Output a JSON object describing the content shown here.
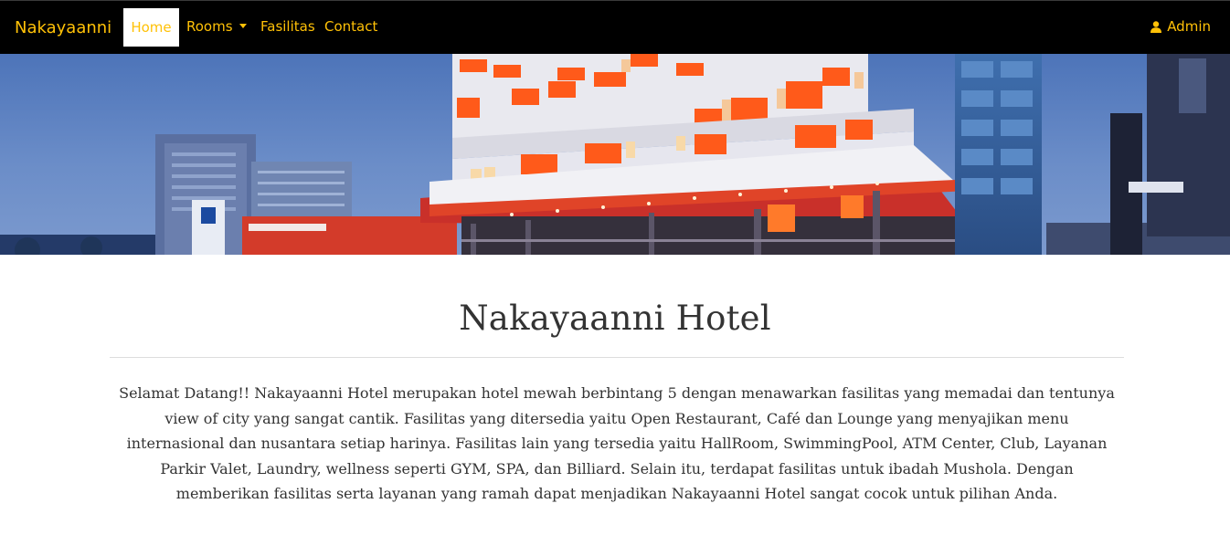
{
  "navbar": {
    "brand": "Nakayaanni",
    "items": [
      {
        "label": "Home",
        "active": true
      },
      {
        "label": "Rooms",
        "dropdown": true
      },
      {
        "label": "Fasilitas"
      },
      {
        "label": "Contact"
      }
    ],
    "user_label": "Admin",
    "user_icon": "user-icon",
    "accent_color": "#ffc107",
    "background_color": "#000000"
  },
  "main": {
    "title": "Nakayaanni Hotel",
    "description": "Selamat Datang!! Nakayaanni Hotel merupakan hotel mewah berbintang 5 dengan menawarkan fasilitas yang memadai dan tentunya view of city yang sangat cantik. Fasilitas yang ditersedia yaitu Open Restaurant, Café dan Lounge yang menyajikan menu internasional dan nusantara setiap harinya. Fasilitas lain yang tersedia yaitu HallRoom, SwimmingPool, ATM Center, Club, Layanan Parkir Valet, Laundry, wellness seperti GYM, SPA, dan Billiard. Selain itu, terdapat fasilitas untuk ibadah Mushola. Dengan memberikan fasilitas serta layanan yang ramah dapat menjadikan Nakayaanni Hotel sangat cocok untuk pilihan Anda."
  }
}
